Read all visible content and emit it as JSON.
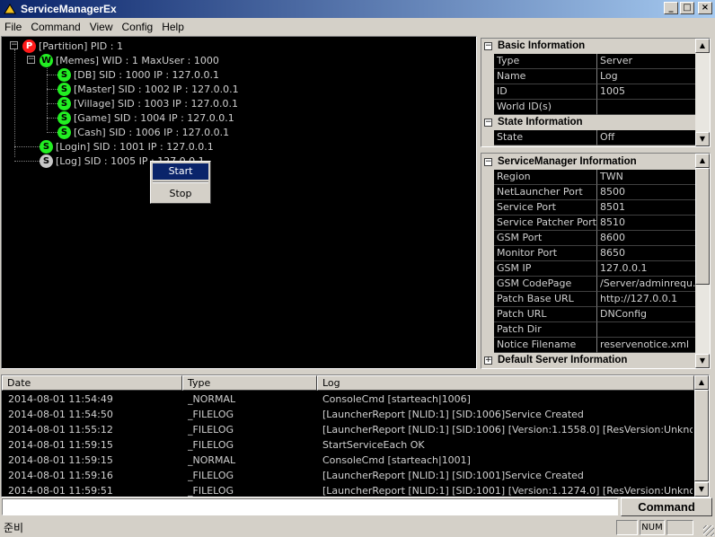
{
  "window": {
    "title": "ServiceManagerEx"
  },
  "menu": [
    "File",
    "Command",
    "View",
    "Config",
    "Help"
  ],
  "tree": {
    "nodes": [
      {
        "badge": "P",
        "color": "#ff1a1a",
        "text": "[Partition] PID : 1"
      },
      {
        "badge": "W",
        "color": "#22ee22",
        "text": "[Memes] WID : 1 MaxUser : 1000"
      },
      {
        "badge": "S",
        "color": "#22ee22",
        "text": "[DB] SID : 1000 IP : 127.0.0.1"
      },
      {
        "badge": "S",
        "color": "#22ee22",
        "text": "[Master] SID : 1002 IP : 127.0.0.1"
      },
      {
        "badge": "S",
        "color": "#22ee22",
        "text": "[Village] SID : 1003 IP : 127.0.0.1"
      },
      {
        "badge": "S",
        "color": "#22ee22",
        "text": "[Game] SID : 1004 IP : 127.0.0.1"
      },
      {
        "badge": "S",
        "color": "#22ee22",
        "text": "[Cash] SID : 1006 IP : 127.0.0.1"
      },
      {
        "badge": "S",
        "color": "#22ee22",
        "text": "[Login] SID : 1001 IP : 127.0.0.1"
      },
      {
        "badge": "S",
        "color": "#c8c8c8",
        "text": "[Log] SID : 1005 IP : 127.0.0.1"
      }
    ],
    "context_menu": {
      "start": "Start",
      "stop": "Stop"
    }
  },
  "basic_info": {
    "category1": "Basic Information",
    "rows1": [
      {
        "k": "Type",
        "v": "Server"
      },
      {
        "k": "Name",
        "v": "Log"
      },
      {
        "k": "ID",
        "v": "1005"
      },
      {
        "k": "World ID(s)",
        "v": ""
      }
    ],
    "category2": "State Information",
    "rows2": [
      {
        "k": "State",
        "v": "Off"
      }
    ]
  },
  "sm_info": {
    "category1": "ServiceManager Information",
    "rows": [
      {
        "k": "Region",
        "v": "TWN"
      },
      {
        "k": "NetLauncher Port",
        "v": "8500"
      },
      {
        "k": "Service Port",
        "v": "8501"
      },
      {
        "k": "Service Patcher Port",
        "v": "8510"
      },
      {
        "k": "GSM Port",
        "v": "8600"
      },
      {
        "k": "Monitor Port",
        "v": "8650"
      },
      {
        "k": "GSM IP",
        "v": "127.0.0.1"
      },
      {
        "k": "GSM CodePage",
        "v": "/Server/adminrequ..."
      },
      {
        "k": "Patch Base URL",
        "v": "http://127.0.0.1"
      },
      {
        "k": "Patch URL",
        "v": "DNConfig"
      },
      {
        "k": "Patch Dir",
        "v": ""
      },
      {
        "k": "Notice Filename",
        "v": "reservenotice.xml"
      }
    ],
    "category2": "Default Server Information"
  },
  "log": {
    "headers": [
      "Date",
      "Type",
      "Log"
    ],
    "rows": [
      [
        "2014-08-01 11:54:49",
        "_NORMAL",
        "ConsoleCmd [starteach|1006]"
      ],
      [
        "2014-08-01 11:54:50",
        "_FILELOG",
        "[LauncherReport [NLID:1] [SID:1006]Service Created"
      ],
      [
        "2014-08-01 11:55:12",
        "_FILELOG",
        "[LauncherReport [NLID:1] [SID:1006] [Version:1.1558.0] [ResVersion:Unknown V..."
      ],
      [
        "2014-08-01 11:59:15",
        "_FILELOG",
        "StartServiceEach OK"
      ],
      [
        "2014-08-01 11:59:15",
        "_NORMAL",
        "ConsoleCmd [starteach|1001]"
      ],
      [
        "2014-08-01 11:59:16",
        "_FILELOG",
        "[LauncherReport [NLID:1] [SID:1001]Service Created"
      ],
      [
        "2014-08-01 11:59:51",
        "_FILELOG",
        "[LauncherReport [NLID:1] [SID:1001] [Version:1.1274.0] [ResVersion:Unknown V..."
      ]
    ]
  },
  "command": {
    "input_value": "",
    "button": "Command"
  },
  "status": {
    "text": "준비",
    "num": "NUM"
  }
}
